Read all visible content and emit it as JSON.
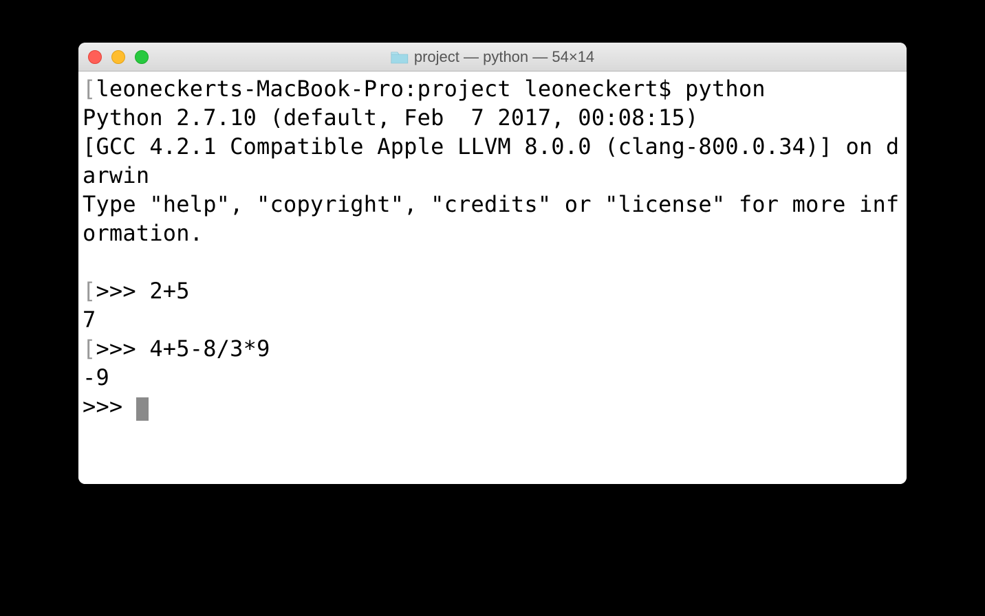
{
  "window": {
    "title": "project — python — 54×14",
    "folder_icon_name": "folder-icon"
  },
  "terminal": {
    "prompt_line": "leoneckerts-MacBook-Pro:project leoneckert$ python",
    "banner": "Python 2.7.10 (default, Feb  7 2017, 00:08:15) \n[GCC 4.2.1 Compatible Apple LLVM 8.0.0 (clang-800.0.34)] on darwin\nType \"help\", \"copyright\", \"credits\" or \"license\" for more information.",
    "repl": [
      {
        "prompt": ">>> ",
        "input": "2+5",
        "output": "7"
      },
      {
        "prompt": ">>> ",
        "input": "4+5-8/3*9",
        "output": "-9"
      }
    ],
    "current_prompt": ">>> "
  }
}
